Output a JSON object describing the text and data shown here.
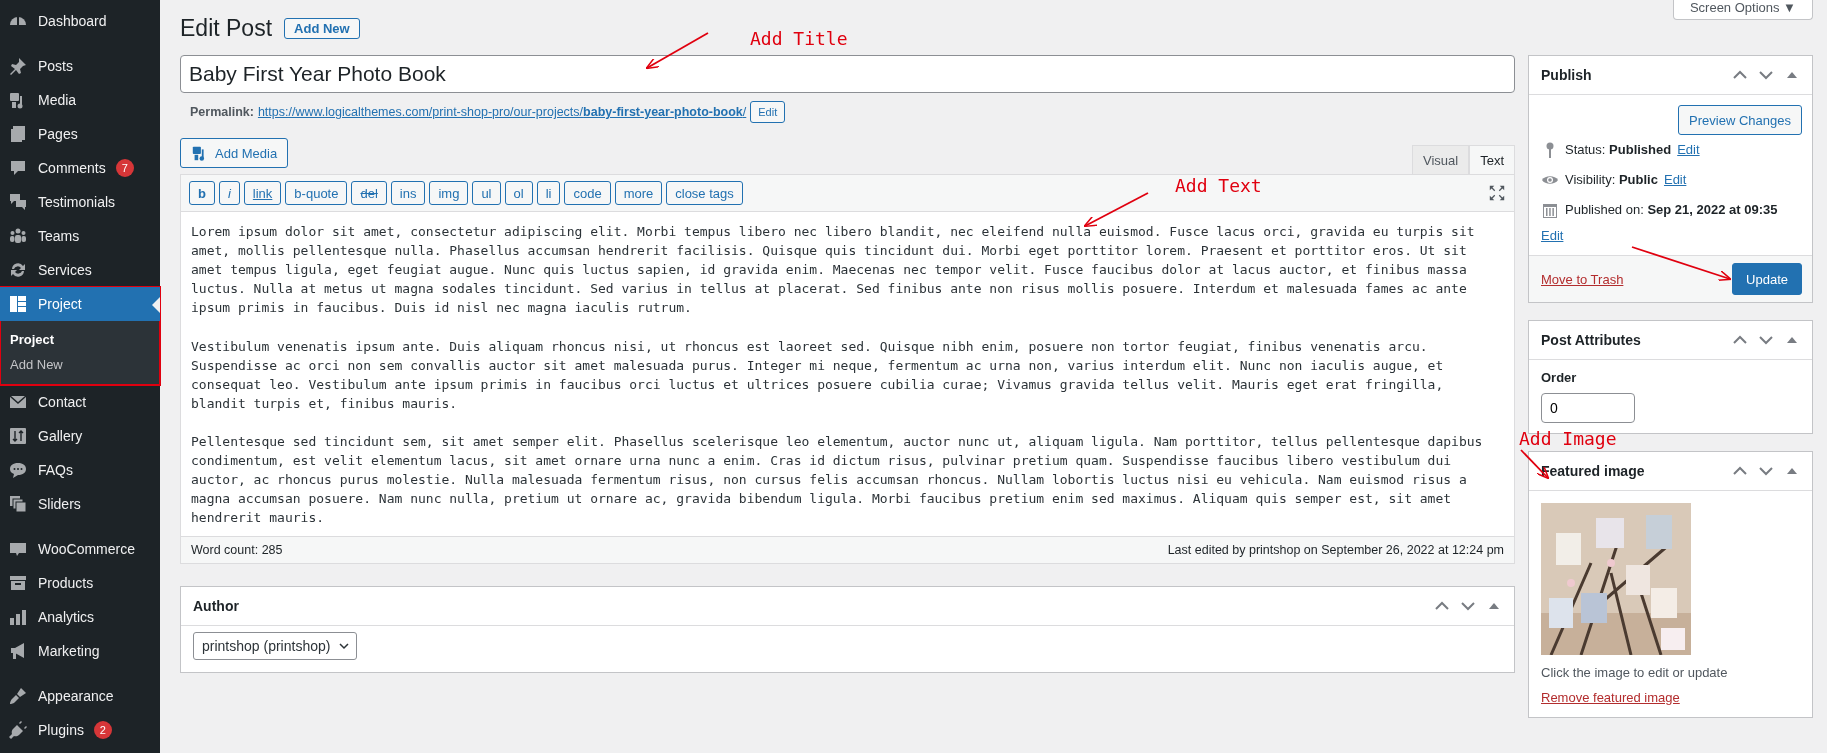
{
  "sidebar": {
    "groups": [
      {
        "items": [
          {
            "label": "Dashboard",
            "selected": false
          }
        ]
      },
      {
        "items": [
          {
            "label": "Posts",
            "selected": false
          },
          {
            "label": "Media",
            "selected": false
          },
          {
            "label": "Pages",
            "selected": false
          },
          {
            "label": "Comments",
            "badge": "7",
            "selected": false
          },
          {
            "label": "Testimonials",
            "selected": false
          },
          {
            "label": "Teams",
            "selected": false
          },
          {
            "label": "Services",
            "selected": false
          },
          {
            "label": "Project",
            "selected": true,
            "highlighted": true,
            "children": [
              {
                "label": "Project",
                "selected": true
              },
              {
                "label": "Add New",
                "selected": false
              }
            ]
          },
          {
            "label": "Contact",
            "selected": false
          },
          {
            "label": "Gallery",
            "selected": false
          },
          {
            "label": "FAQs",
            "selected": false
          },
          {
            "label": "Sliders",
            "selected": false
          }
        ]
      },
      {
        "items": [
          {
            "label": "WooCommerce",
            "selected": false
          },
          {
            "label": "Products",
            "selected": false
          },
          {
            "label": "Analytics",
            "selected": false
          },
          {
            "label": "Marketing",
            "selected": false
          }
        ]
      },
      {
        "items": [
          {
            "label": "Appearance",
            "selected": false
          },
          {
            "label": "Plugins",
            "badge": "2",
            "selected": false
          }
        ]
      }
    ]
  },
  "screen_options": "Screen Options ▼",
  "heading": {
    "title": "Edit Post",
    "add_new": "Add New"
  },
  "title_field": {
    "value": "Baby First Year Photo Book"
  },
  "permalink": {
    "label": "Permalink:",
    "url": "https://www.logicalthemes.com/print-shop-pro/our-projects/**baby-first-year-photo-book**/",
    "edit": "Edit"
  },
  "add_media": "Add Media",
  "editor_tabs": [
    {
      "label": "Visual",
      "selected": false
    },
    {
      "label": "Text",
      "selected": true
    }
  ],
  "quicktags": [
    {
      "label": "b",
      "kind": "bold"
    },
    {
      "label": "i",
      "kind": "italic"
    },
    {
      "label": "link",
      "kind": "underline"
    },
    {
      "label": "b-quote",
      "kind": "plain"
    },
    {
      "label": "del",
      "kind": "strike"
    },
    {
      "label": "ins",
      "kind": "plain"
    },
    {
      "label": "img",
      "kind": "plain"
    },
    {
      "label": "ul",
      "kind": "plain"
    },
    {
      "label": "ol",
      "kind": "plain"
    },
    {
      "label": "li",
      "kind": "plain"
    },
    {
      "label": "code",
      "kind": "plain"
    },
    {
      "label": "more",
      "kind": "plain"
    },
    {
      "label": "close tags",
      "kind": "plain"
    }
  ],
  "content": [
    "Lorem ipsum dolor sit amet, consectetur adipiscing elit. Morbi tempus libero nec libero blandit, nec eleifend nulla euismod. Fusce lacus orci, gravida eu turpis sit amet, mollis pellentesque nulla. Phasellus accumsan hendrerit facilisis. Quisque quis tincidunt dui. Morbi eget porttitor lorem. Praesent et porttitor eros. Ut sit amet tempus ligula, eget feugiat augue. Nunc quis luctus sapien, id gravida enim. Maecenas nec tempor velit. Fusce faucibus dolor at lacus auctor, et finibus massa luctus. Nulla at metus ut magna sodales tincidunt. Sed varius in tellus at placerat. Sed finibus ante non risus mollis posuere. Interdum et malesuada fames ac ante ipsum primis in faucibus. Duis id nisl nec magna iaculis rutrum.",
    "Vestibulum venenatis ipsum ante. Duis aliquam rhoncus nisi, ut rhoncus est laoreet sed. Quisque nibh enim, posuere non tortor feugiat, finibus venenatis arcu. Suspendisse ac orci non sem convallis auctor sit amet malesuada purus. Integer mi neque, fermentum ac urna non, varius interdum elit. Nunc non iaculis augue, et consequat leo. Vestibulum ante ipsum primis in faucibus orci luctus et ultrices posuere cubilia curae; Vivamus gravida tellus velit. Mauris eget erat fringilla, blandit turpis et, finibus mauris.",
    "Pellentesque sed tincidunt sem, sit amet semper elit. Phasellus scelerisque leo elementum, auctor nunc ut, aliquam ligula. Nam porttitor, tellus pellentesque dapibus condimentum, est velit elementum lacus, sit amet ornare urna nunc a enim. Cras id dictum risus, pulvinar pretium quam. Suspendisse faucibus libero vestibulum dui auctor, ac rhoncus purus molestie. Nulla malesuada fermentum risus, non cursus felis accumsan rhoncus. Nullam lobortis luctus nisi eu vehicula. Nam euismod risus a magna accumsan posuere. Nam nunc nulla, pretium ut ornare ac, gravida bibendum ligula. Morbi faucibus pretium enim sed maximus. Aliquam quis semper est, sit amet hendrerit mauris."
  ],
  "word_count": "Word count: 285",
  "last_edited": "Last edited by printshop on September 26, 2022 at 12:24 pm",
  "author_box": {
    "title": "Author",
    "value": "printshop (printshop)"
  },
  "publish_box": {
    "title": "Publish",
    "preview": "Preview Changes",
    "rows": [
      {
        "text": "Status: **Published**",
        "link": "Edit"
      },
      {
        "text": "Visibility: **Public**",
        "link": "Edit"
      },
      {
        "text": "Published on: **Sep 21, 2022 at 09:35**",
        "link": "Edit"
      }
    ],
    "trash": "Move to Trash",
    "update": "Update"
  },
  "attributes_box": {
    "title": "Post Attributes",
    "order_label": "Order",
    "order_value": "0"
  },
  "featured_box": {
    "title": "Featured image",
    "hint": "Click the image to edit or update",
    "remove": "Remove featured image"
  },
  "annotations": [
    {
      "text": "Add Title"
    },
    {
      "text": "Add Text"
    },
    {
      "text": "Add Image"
    }
  ]
}
